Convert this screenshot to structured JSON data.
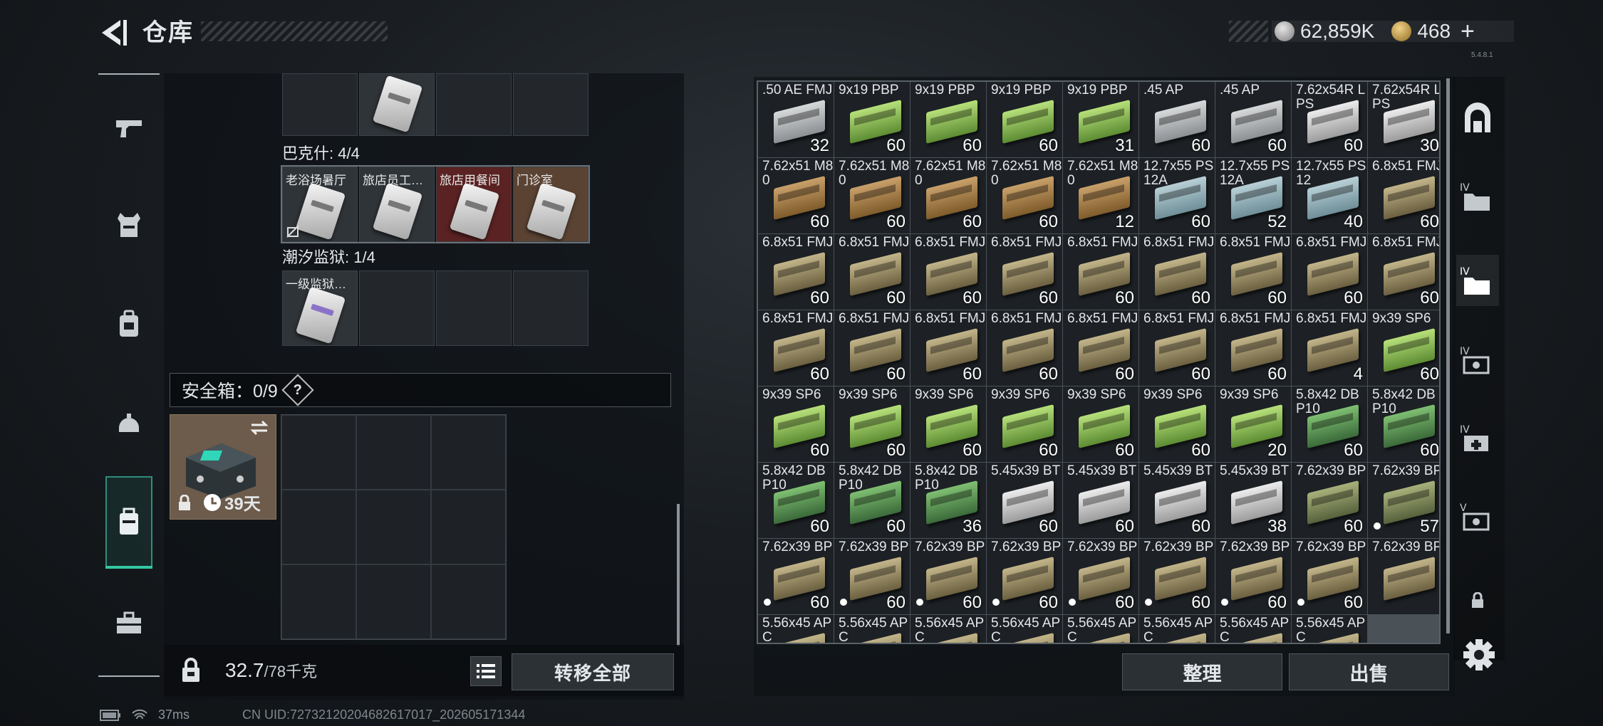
{
  "header": {
    "title": "仓库",
    "silver": "62,859K",
    "gold": "468",
    "plus": "+",
    "version": "5.4.8.1"
  },
  "left": {
    "group1": {
      "cells": [
        {
          "label": "",
          "card": "plain"
        }
      ]
    },
    "group2": {
      "title": "巴克什: 4/4",
      "cells": [
        {
          "label": "老浴场暑厅",
          "color": "filled",
          "card": "plain",
          "no_icon": true
        },
        {
          "label": "旅店员工…",
          "color": "filled",
          "card": "plain"
        },
        {
          "label": "旅店用餐间",
          "color": "red",
          "card": "plain"
        },
        {
          "label": "门诊室",
          "color": "brown",
          "card": "plain"
        }
      ]
    },
    "group3": {
      "title": "潮汐监狱: 1/4",
      "cells": [
        {
          "label": "一级监狱…",
          "color": "filled",
          "card": "purple"
        }
      ]
    },
    "safe": {
      "title": "安全箱：0/9",
      "help": "?",
      "days": "39天"
    },
    "weight": {
      "current": "32.7",
      "max": "/78千克"
    },
    "transfer_label": "转移全部"
  },
  "ammo": [
    {
      "c": ".50 AE FMJ",
      "n": "32",
      "col": "b-silver"
    },
    {
      "c": "9x19 PBP",
      "n": "60",
      "col": "b-green"
    },
    {
      "c": "9x19 PBP",
      "n": "60",
      "col": "b-green"
    },
    {
      "c": "9x19 PBP",
      "n": "60",
      "col": "b-green"
    },
    {
      "c": "9x19 PBP",
      "n": "31",
      "col": "b-green"
    },
    {
      "c": ".45 AP",
      "n": "60",
      "col": "b-silver"
    },
    {
      "c": ".45 AP",
      "n": "60",
      "col": "b-silver"
    },
    {
      "c": "7.62x54R LPS",
      "n": "60",
      "col": "b-white"
    },
    {
      "c": "7.62x54R LPS",
      "n": "30",
      "col": "b-white"
    },
    {
      "c": "7.62x51 M80",
      "n": "60",
      "col": "b-tan"
    },
    {
      "c": "7.62x51 M80",
      "n": "60",
      "col": "b-tan"
    },
    {
      "c": "7.62x51 M80",
      "n": "60",
      "col": "b-tan"
    },
    {
      "c": "7.62x51 M80",
      "n": "60",
      "col": "b-tan"
    },
    {
      "c": "7.62x51 M80",
      "n": "12",
      "col": "b-tan"
    },
    {
      "c": "12.7x55 PS12A",
      "n": "60",
      "col": "b-blue"
    },
    {
      "c": "12.7x55 PS12A",
      "n": "52",
      "col": "b-blue"
    },
    {
      "c": "12.7x55 PS12",
      "n": "40",
      "col": "b-blue"
    },
    {
      "c": "6.8x51 FMJ",
      "n": "60",
      "col": "b-olive"
    },
    {
      "c": "6.8x51 FMJ",
      "n": "60",
      "col": "b-olive"
    },
    {
      "c": "6.8x51 FMJ",
      "n": "60",
      "col": "b-olive"
    },
    {
      "c": "6.8x51 FMJ",
      "n": "60",
      "col": "b-olive"
    },
    {
      "c": "6.8x51 FMJ",
      "n": "60",
      "col": "b-olive"
    },
    {
      "c": "6.8x51 FMJ",
      "n": "60",
      "col": "b-olive"
    },
    {
      "c": "6.8x51 FMJ",
      "n": "60",
      "col": "b-olive"
    },
    {
      "c": "6.8x51 FMJ",
      "n": "60",
      "col": "b-olive"
    },
    {
      "c": "6.8x51 FMJ",
      "n": "60",
      "col": "b-olive"
    },
    {
      "c": "6.8x51 FMJ",
      "n": "60",
      "col": "b-olive"
    },
    {
      "c": "6.8x51 FMJ",
      "n": "60",
      "col": "b-olive"
    },
    {
      "c": "6.8x51 FMJ",
      "n": "60",
      "col": "b-olive"
    },
    {
      "c": "6.8x51 FMJ",
      "n": "60",
      "col": "b-olive"
    },
    {
      "c": "6.8x51 FMJ",
      "n": "60",
      "col": "b-olive"
    },
    {
      "c": "6.8x51 FMJ",
      "n": "60",
      "col": "b-olive"
    },
    {
      "c": "6.8x51 FMJ",
      "n": "60",
      "col": "b-olive"
    },
    {
      "c": "6.8x51 FMJ",
      "n": "60",
      "col": "b-olive"
    },
    {
      "c": "6.8x51 FMJ",
      "n": "4",
      "col": "b-olive"
    },
    {
      "c": "9x39 SP6",
      "n": "60",
      "col": "b-green"
    },
    {
      "c": "9x39 SP6",
      "n": "60",
      "col": "b-green"
    },
    {
      "c": "9x39 SP6",
      "n": "60",
      "col": "b-green"
    },
    {
      "c": "9x39 SP6",
      "n": "60",
      "col": "b-green"
    },
    {
      "c": "9x39 SP6",
      "n": "60",
      "col": "b-green"
    },
    {
      "c": "9x39 SP6",
      "n": "60",
      "col": "b-green"
    },
    {
      "c": "9x39 SP6",
      "n": "60",
      "col": "b-green"
    },
    {
      "c": "9x39 SP6",
      "n": "20",
      "col": "b-green"
    },
    {
      "c": "5.8x42 DBP10",
      "n": "60",
      "col": "b-dkgreen"
    },
    {
      "c": "5.8x42 DBP10",
      "n": "60",
      "col": "b-dkgreen"
    },
    {
      "c": "5.8x42 DBP10",
      "n": "60",
      "col": "b-dkgreen"
    },
    {
      "c": "5.8x42 DBP10",
      "n": "60",
      "col": "b-dkgreen"
    },
    {
      "c": "5.8x42 DBP10",
      "n": "36",
      "col": "b-dkgreen"
    },
    {
      "c": "5.45x39 BT",
      "n": "60",
      "col": "b-white"
    },
    {
      "c": "5.45x39 BT",
      "n": "60",
      "col": "b-white"
    },
    {
      "c": "5.45x39 BT",
      "n": "60",
      "col": "b-white"
    },
    {
      "c": "5.45x39 BT",
      "n": "38",
      "col": "b-white"
    },
    {
      "c": "7.62x39 BP",
      "n": "60",
      "col": "b-olivegreen"
    },
    {
      "c": "7.62x39 BP",
      "n": "57",
      "col": "b-olivegreen",
      "dot": true
    },
    {
      "c": "7.62x39 BP",
      "n": "60",
      "col": "b-olive",
      "dot": true
    },
    {
      "c": "7.62x39 BP",
      "n": "60",
      "col": "b-olive",
      "dot": true
    },
    {
      "c": "7.62x39 BP",
      "n": "60",
      "col": "b-olive",
      "dot": true
    },
    {
      "c": "7.62x39 BP",
      "n": "60",
      "col": "b-olive",
      "dot": true
    },
    {
      "c": "7.62x39 BP",
      "n": "60",
      "col": "b-olive",
      "dot": true
    },
    {
      "c": "7.62x39 BP",
      "n": "60",
      "col": "b-olive",
      "dot": true
    },
    {
      "c": "7.62x39 BP",
      "n": "60",
      "col": "b-olive",
      "dot": true
    },
    {
      "c": "7.62x39 BP",
      "n": "60",
      "col": "b-olive",
      "dot": true
    },
    {
      "c": "7.62x39 BP",
      "n": "",
      "col": "b-olive"
    },
    {
      "c": "5.56x45 APC",
      "n": "",
      "col": "b-olive"
    },
    {
      "c": "5.56x45 APC",
      "n": "",
      "col": "b-olive"
    },
    {
      "c": "5.56x45 APC",
      "n": "",
      "col": "b-olive"
    },
    {
      "c": "5.56x45 APC",
      "n": "",
      "col": "b-olive"
    },
    {
      "c": "5.56x45 APC",
      "n": "",
      "col": "b-olive"
    },
    {
      "c": "5.56x45 APC",
      "n": "",
      "col": "b-olive"
    },
    {
      "c": "5.56x45 APC",
      "n": "",
      "col": "b-olive"
    },
    {
      "c": "5.56x45 APC",
      "n": "",
      "col": "b-olive"
    }
  ],
  "buttons": {
    "sort": "整理",
    "sell": "出售"
  },
  "status": {
    "ping": "37ms",
    "uid": "CN UID:727321202046826170​17_202605171344"
  },
  "colors": {
    "accent": "#33c7a2",
    "panel": "#1d2125"
  }
}
